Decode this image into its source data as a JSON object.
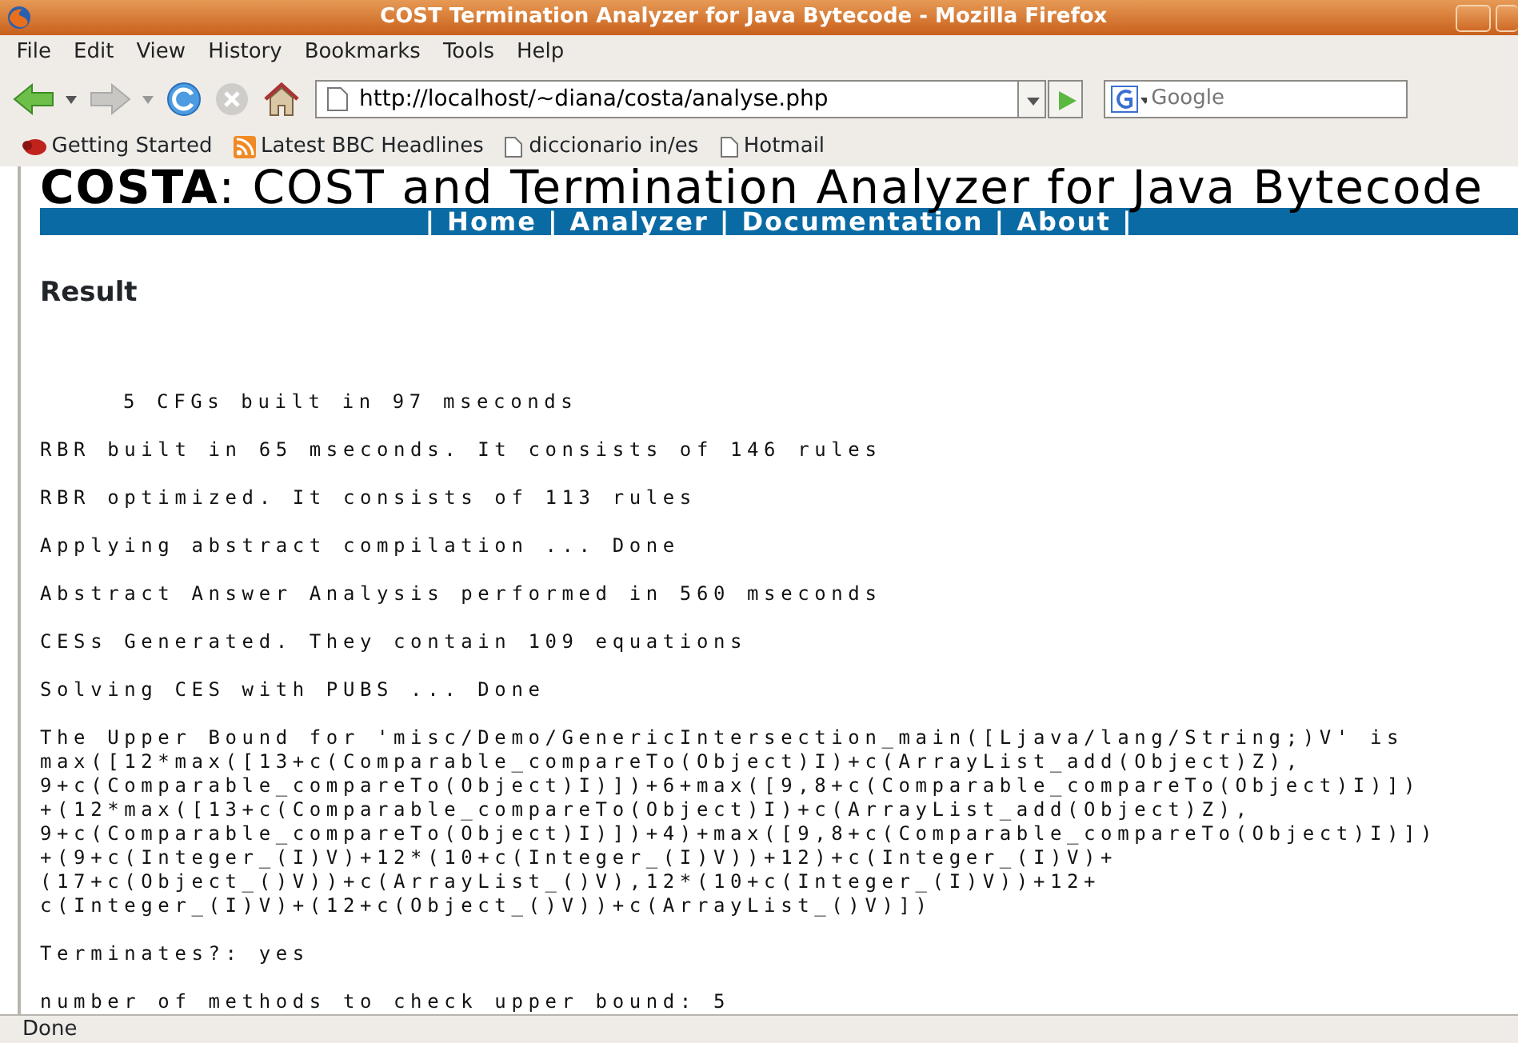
{
  "window": {
    "title": "COST Termination Analyzer for Java Bytecode - Mozilla Firefox"
  },
  "menu": [
    "File",
    "Edit",
    "View",
    "History",
    "Bookmarks",
    "Tools",
    "Help"
  ],
  "address": {
    "value": "http://localhost/~diana/costa/analyse.php"
  },
  "search": {
    "placeholder": "Google"
  },
  "bookmarks": [
    "Getting Started",
    "Latest BBC Headlines",
    "diccionario in/es",
    "Hotmail"
  ],
  "page": {
    "brand": "COSTA",
    "heading": ": COST and Termination Analyzer for Java Bytecode",
    "nav_links": [
      "Home",
      "Analyzer",
      "Documentation",
      "About"
    ],
    "nav_separators": [
      "|",
      "|",
      "|",
      "|",
      "|"
    ],
    "section": "Result",
    "output": [
      {
        "kind": "indented",
        "lines": [
          "5 CFGs built in 97 mseconds"
        ]
      },
      {
        "kind": "plain",
        "lines": [
          "RBR built in 65 mseconds. It consists of 146 rules"
        ]
      },
      {
        "kind": "plain",
        "lines": [
          "RBR optimized. It consists of 113 rules"
        ]
      },
      {
        "kind": "plain",
        "lines": [
          "Applying abstract compilation ... Done"
        ]
      },
      {
        "kind": "plain",
        "lines": [
          "Abstract Answer Analysis performed in 560 mseconds"
        ]
      },
      {
        "kind": "plain",
        "lines": [
          "CESs Generated. They contain 109 equations"
        ]
      },
      {
        "kind": "plain",
        "lines": [
          "Solving CES with PUBS ... Done"
        ]
      },
      {
        "kind": "plain",
        "lines": [
          "The Upper Bound for 'misc/Demo/GenericIntersection_main([Ljava/lang/String;)V' is",
          "max([12*max([13+c(Comparable_compareTo(Object)I)+c(ArrayList_add(Object)Z),",
          "9+c(Comparable_compareTo(Object)I)])+6+max([9,8+c(Comparable_compareTo(Object)I)])",
          "+(12*max([13+c(Comparable_compareTo(Object)I)+c(ArrayList_add(Object)Z),",
          "9+c(Comparable_compareTo(Object)I)])+4)+max([9,8+c(Comparable_compareTo(Object)I)])",
          "+(9+c(Integer_(I)V)+12*(10+c(Integer_(I)V))+12)+c(Integer_(I)V)+",
          "(17+c(Object_()V))+c(ArrayList_()V),12*(10+c(Integer_(I)V))+12+",
          "c(Integer_(I)V)+(12+c(Object_()V))+c(ArrayList_()V)])"
        ]
      },
      {
        "kind": "plain",
        "lines": [
          "Terminates?: yes"
        ]
      },
      {
        "kind": "plain",
        "lines": [
          "number of methods to check upper bound: 5"
        ]
      }
    ]
  },
  "status_bar": "Done"
}
